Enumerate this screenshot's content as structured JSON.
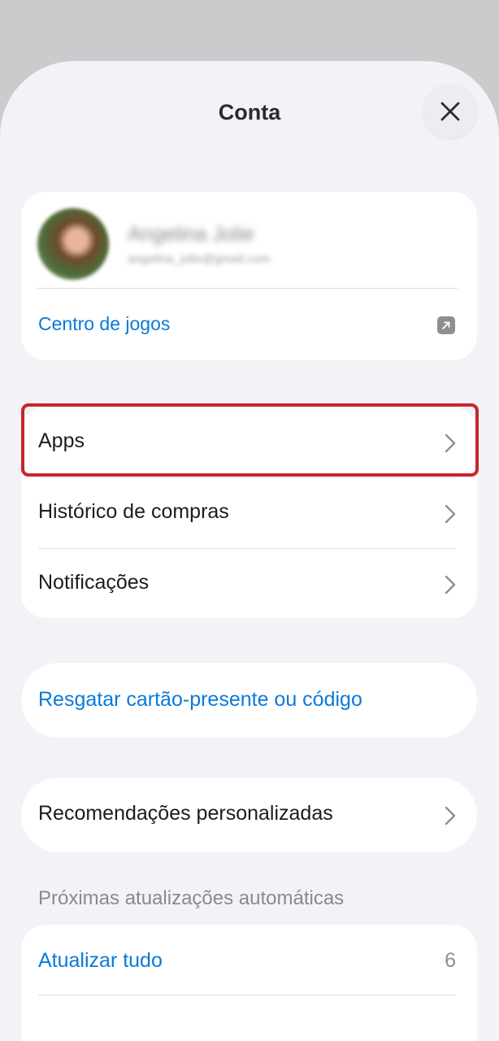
{
  "header": {
    "title": "Conta"
  },
  "profile": {
    "name": "Angelina Jolie",
    "email": "angelina_jolie@gmail.com",
    "games_center_label": "Centro de jogos"
  },
  "menu": {
    "items": [
      {
        "label": "Apps"
      },
      {
        "label": "Histórico de compras"
      },
      {
        "label": "Notificações"
      }
    ]
  },
  "redeem": {
    "label": "Resgatar cartão-presente ou código"
  },
  "recommendations": {
    "label": "Recomendações personalizadas"
  },
  "updates": {
    "section_title": "Próximas atualizações automáticas",
    "update_all_label": "Atualizar tudo",
    "count": "6"
  },
  "colors": {
    "accent": "#0a7ad8",
    "highlight": "#c7262c"
  },
  "icons": [
    "close-icon",
    "external-link-icon",
    "chevron-right-icon"
  ]
}
